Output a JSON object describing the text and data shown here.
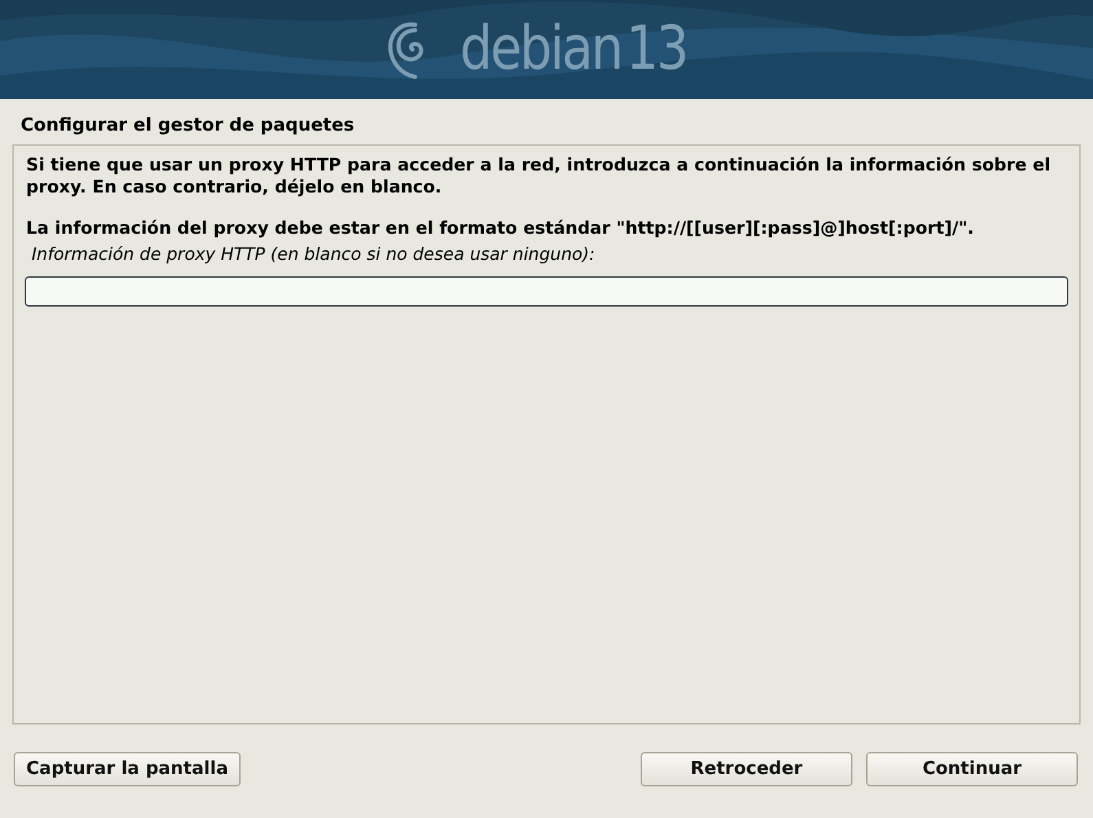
{
  "banner": {
    "logo_text": "debian",
    "version": "13"
  },
  "page_title": "Configurar el gestor de paquetes",
  "paragraphs": [
    "Si tiene que usar un proxy HTTP para acceder a la red, introduzca a continuación la información sobre el proxy. En caso contrario, déjelo en blanco.",
    "La información del proxy debe estar en el formato estándar \"http://[[user][:pass]@]host[:port]/\"."
  ],
  "field": {
    "label": "Información de proxy HTTP (en blanco si no desea usar ninguno):"
  },
  "buttons_left": [
    "Capturar la pantalla"
  ],
  "buttons_right": [
    "Retroceder",
    "Continuar"
  ]
}
